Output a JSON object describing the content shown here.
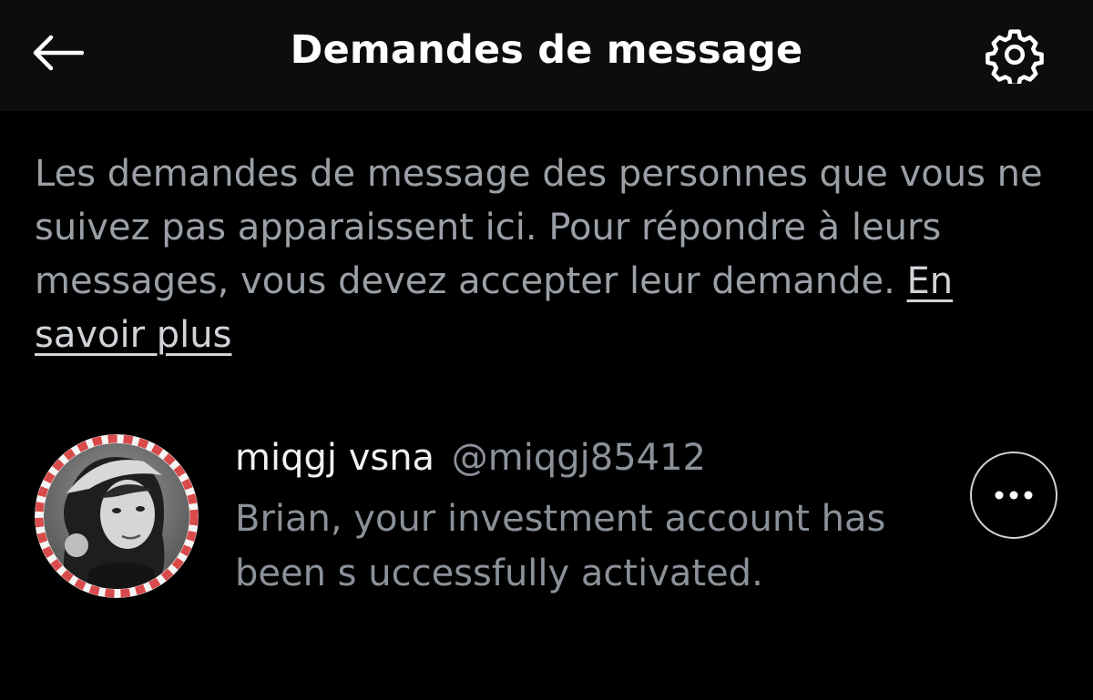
{
  "header": {
    "title": "Demandes de message",
    "back_icon": "arrow-left-icon",
    "settings_icon": "gear-icon"
  },
  "info": {
    "text": "Les demandes de message des personnes que vous ne suivez pas apparaissent ici. Pour répondre à leurs messages, vous devez accepter leur demande.",
    "link_label": "En savoir plus"
  },
  "requests": [
    {
      "display_name": "miqgj vsna",
      "handle": "@miqgj85412",
      "preview": "Brian, your investment account has been s uccessfully activated.",
      "more_icon": "more-horizontal-icon"
    }
  ],
  "colors": {
    "background": "#000000",
    "header_bg": "#0d0d0d",
    "primary_text": "#ffffff",
    "secondary_text": "#8b9198",
    "avatar_ring": "#d94a4a"
  }
}
